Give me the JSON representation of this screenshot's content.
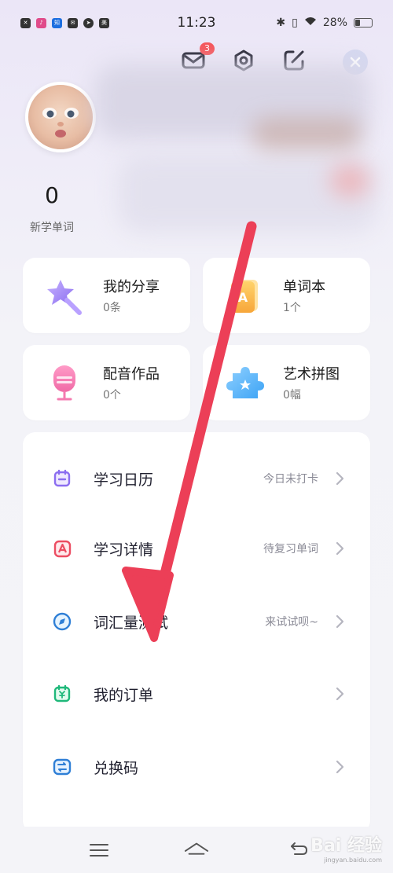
{
  "status_bar": {
    "time": "11:23",
    "battery": "28%",
    "apps": [
      "close-app-icon",
      "music-app-icon",
      "zhihu-app-icon",
      "mail-app-icon",
      "compass-app-icon",
      "food-app-icon"
    ]
  },
  "header": {
    "message_badge": "3",
    "icons": [
      "mail-icon",
      "settings-icon",
      "edit-icon",
      "close-icon"
    ]
  },
  "stats": [
    {
      "value": "0",
      "label": "新学单词"
    }
  ],
  "feature_cards": [
    {
      "title": "我的分享",
      "subtitle": "0条",
      "icon": "magic-wand-icon"
    },
    {
      "title": "单词本",
      "subtitle": "1个",
      "icon": "wordbook-icon"
    },
    {
      "title": "配音作品",
      "subtitle": "0个",
      "icon": "microphone-icon"
    },
    {
      "title": "艺术拼图",
      "subtitle": "0幅",
      "icon": "puzzle-icon"
    }
  ],
  "menu": [
    {
      "label": "学习日历",
      "right": "今日未打卡",
      "icon": "calendar-icon"
    },
    {
      "label": "学习详情",
      "right": "待复习单词",
      "icon": "study-detail-icon"
    },
    {
      "label": "词汇量测试",
      "right": "来试试呗~",
      "icon": "compass-icon"
    },
    {
      "label": "我的订单",
      "right": "",
      "icon": "order-icon"
    },
    {
      "label": "兑换码",
      "right": "",
      "icon": "exchange-code-icon"
    }
  ],
  "colors": {
    "accent_red": "#f5555a",
    "arrow": "#ec3f57",
    "purple": "#8b6df0",
    "orange": "#f7a63a",
    "pink": "#f06aa6",
    "blue": "#3ca3f5"
  },
  "watermark": {
    "brand": "Bai 经验",
    "url": "jingyan.baidu.com"
  }
}
